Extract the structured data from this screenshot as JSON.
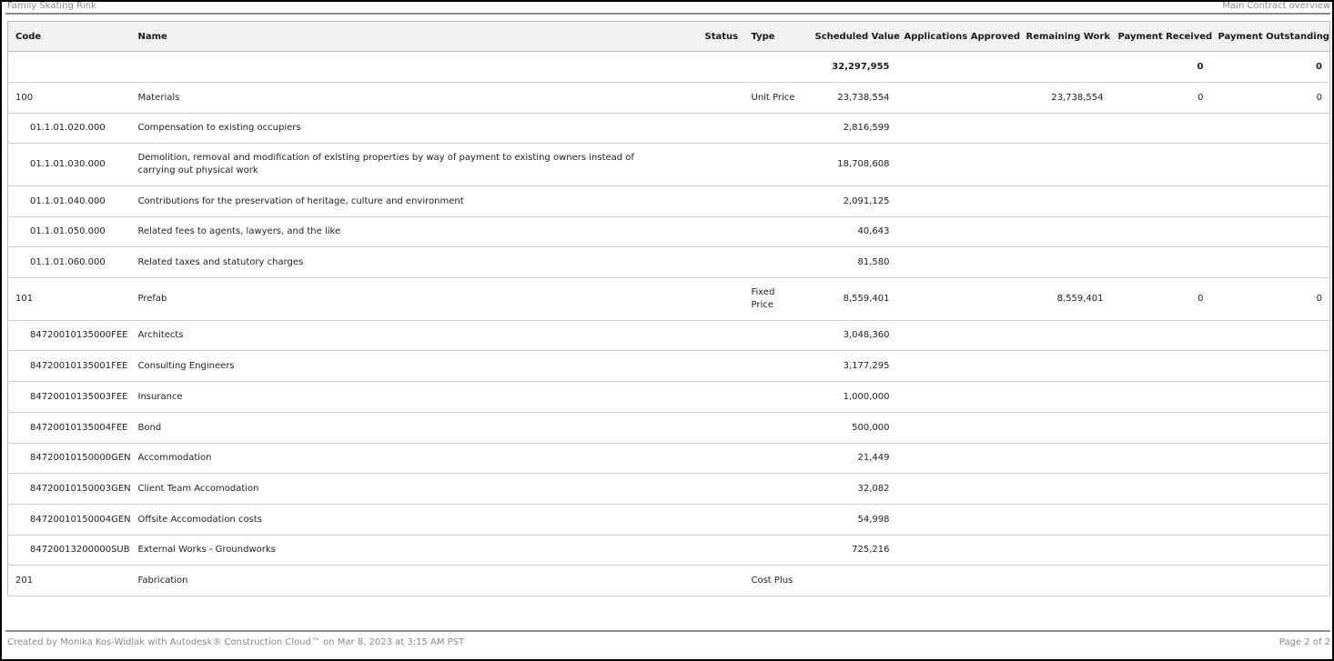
{
  "header": {
    "project": "Family Skating Rink",
    "report_title": "Main Contract overview"
  },
  "footer": {
    "created_by": "Created by Monika Kos-Widlak with Autodesk® Construction Cloud™ on Mar 8, 2023 at 3:15 AM PST",
    "page": "Page 2 of 2"
  },
  "table": {
    "columns": {
      "code": "Code",
      "name": "Name",
      "status": "Status",
      "type": "Type",
      "scheduled_value": "Scheduled Value",
      "applications_approved": "Applications Approved",
      "remaining_work": "Remaining Work",
      "payment_received": "Payment Received",
      "payment_outstanding": "Payment Outstanding"
    },
    "total_row": {
      "scheduled_value": "32,297,955",
      "payment_received": "0",
      "payment_outstanding": "0"
    },
    "rows": [
      {
        "code": "100",
        "name": "Materials",
        "type": "Unit Price",
        "scheduled_value": "23,738,554",
        "remaining_work": "23,738,554",
        "payment_received": "0",
        "payment_outstanding": "0"
      },
      {
        "code": "01.1.01.020.000",
        "name": "Compensation to existing occupiers",
        "scheduled_value": "2,816,599"
      },
      {
        "code": "01.1.01.030.000",
        "name": "Demolition, removal and modification of existing properties by way of payment to existing owners instead of carrying out physical work",
        "scheduled_value": "18,708,608"
      },
      {
        "code": "01.1.01.040.000",
        "name": "Contributions for the preservation of heritage, culture and environment",
        "scheduled_value": "2,091,125"
      },
      {
        "code": "01.1.01.050.000",
        "name": "Related fees to agents, lawyers, and the like",
        "scheduled_value": "40,643"
      },
      {
        "code": "01.1.01.060.000",
        "name": "Related taxes and statutory charges",
        "scheduled_value": "81,580"
      },
      {
        "code": "101",
        "name": "Prefab",
        "type": "Fixed Price",
        "scheduled_value": "8,559,401",
        "remaining_work": "8,559,401",
        "payment_received": "0",
        "payment_outstanding": "0"
      },
      {
        "code": "84720010135000FEE",
        "name": "Architects",
        "scheduled_value": "3,048,360"
      },
      {
        "code": "84720010135001FEE",
        "name": "Consulting Engineers",
        "scheduled_value": "3,177,295"
      },
      {
        "code": "84720010135003FEE",
        "name": "Insurance",
        "scheduled_value": "1,000,000"
      },
      {
        "code": "84720010135004FEE",
        "name": "Bond",
        "scheduled_value": "500,000"
      },
      {
        "code": "84720010150000GEN",
        "name": "Accommodation",
        "scheduled_value": "21,449"
      },
      {
        "code": "84720010150003GEN",
        "name": "Client Team Accomodation",
        "scheduled_value": "32,082"
      },
      {
        "code": "84720010150004GEN",
        "name": "Offsite Accomodation costs",
        "scheduled_value": "54,998"
      },
      {
        "code": "84720013200000SUB",
        "name": "External Works - Groundworks",
        "scheduled_value": "725,216"
      },
      {
        "code": "201",
        "name": "Fabrication",
        "type": "Cost Plus"
      }
    ]
  }
}
